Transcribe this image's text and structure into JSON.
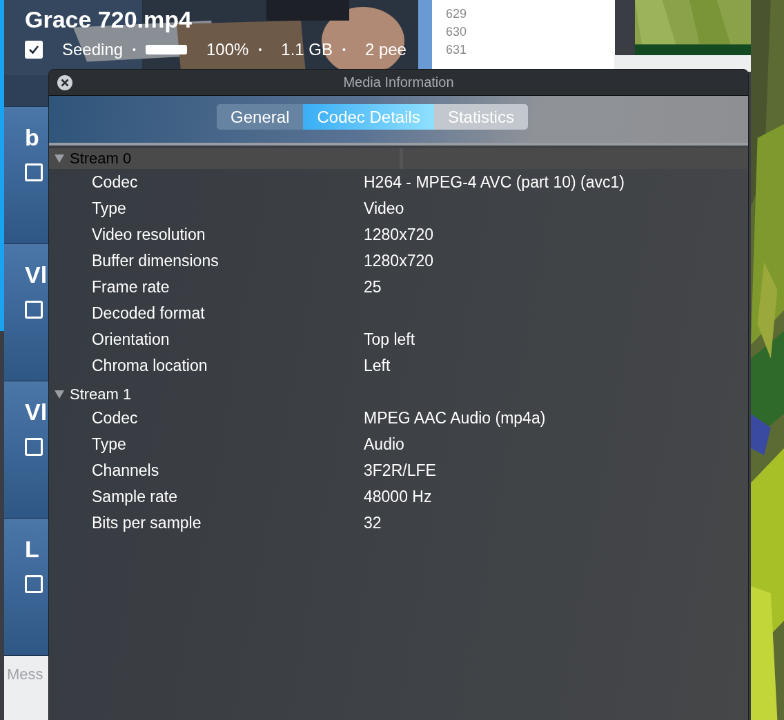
{
  "torrents": [
    {
      "title": "Grace 720.mp4",
      "checked": true,
      "details": [
        {
          "kind": "text",
          "text": "Seeding"
        },
        {
          "kind": "separator",
          "text": "•"
        },
        {
          "kind": "bar",
          "level": 1
        },
        {
          "kind": "text",
          "text": "100%"
        },
        {
          "kind": "separator",
          "text": "•"
        },
        {
          "kind": "text",
          "text": "1.1 GB"
        },
        {
          "kind": "separator",
          "text": "•"
        },
        {
          "kind": "text",
          "text": "2 pee"
        }
      ]
    },
    {
      "title": "b",
      "checked": false
    },
    {
      "title": "Vl",
      "checked": false
    },
    {
      "title": "Vl",
      "checked": false
    },
    {
      "title": "L",
      "checked": false
    }
  ],
  "message": {
    "placeholder": "Mess"
  },
  "editor": {
    "line_numbers": [
      "629",
      "630",
      "631"
    ]
  },
  "window": {
    "title": "Media Information",
    "tabs": [
      {
        "label": "General",
        "selected": false
      },
      {
        "label": "Codec Details",
        "selected": true
      },
      {
        "label": "Statistics",
        "selected": false
      }
    ],
    "streams": [
      {
        "name": "Stream 0",
        "expanded": true,
        "selected": true,
        "rows": [
          {
            "label": "Codec",
            "value": "H264 - MPEG-4 AVC (part 10) (avc1)"
          },
          {
            "label": "Type",
            "value": "Video"
          },
          {
            "label": "Video resolution",
            "value": "1280x720"
          },
          {
            "label": "Buffer dimensions",
            "value": "1280x720"
          },
          {
            "label": "Frame rate",
            "value": "25"
          },
          {
            "label": "Decoded format"
          },
          {
            "label": "Orientation",
            "value": "Top left"
          },
          {
            "label": "Chroma location",
            "value": "Left"
          }
        ]
      },
      {
        "name": "Stream 1",
        "expanded": true,
        "selected": false,
        "rows": [
          {
            "label": "Codec",
            "value": "MPEG AAC Audio (mp4a)"
          },
          {
            "label": "Type",
            "value": "Audio"
          },
          {
            "label": "Channels",
            "value": "3F2R/LFE"
          },
          {
            "label": "Sample rate",
            "value": "48000 Hz"
          },
          {
            "label": "Bits per sample",
            "value": "32"
          }
        ]
      }
    ]
  }
}
